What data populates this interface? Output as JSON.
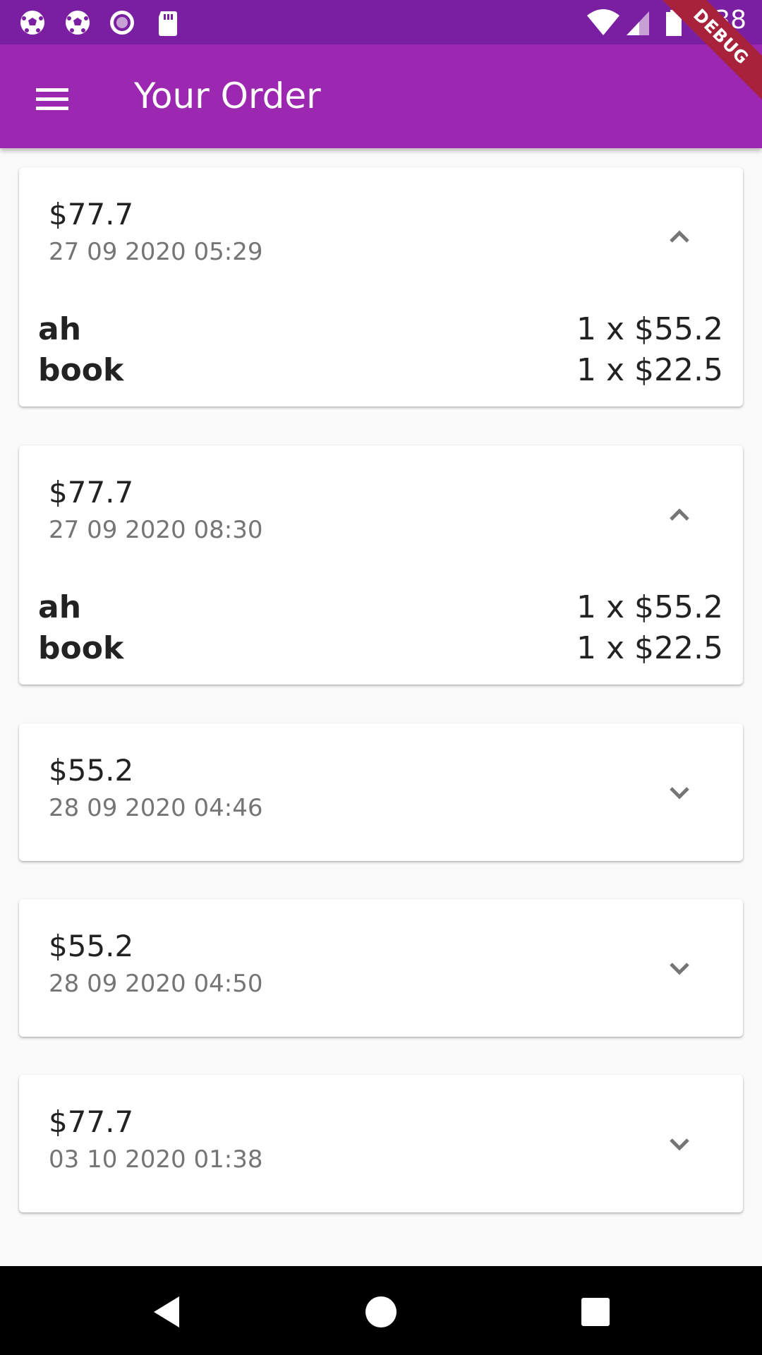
{
  "status_bar": {
    "time": "1:38",
    "icons": [
      "soccer-ball-icon",
      "soccer-ball-icon",
      "record-icon",
      "sd-card-icon",
      "wifi-icon",
      "signal-icon",
      "battery-icon"
    ]
  },
  "debug_banner": "DEBUG",
  "app_bar": {
    "menu_icon": "menu-icon",
    "title": "Your Order"
  },
  "orders": [
    {
      "amount": "$77.7",
      "date": "27 09 2020 05:29",
      "expanded": true,
      "items": [
        {
          "name": "ah",
          "qty": "1 x $55.2"
        },
        {
          "name": "book",
          "qty": "1 x $22.5"
        }
      ]
    },
    {
      "amount": "$77.7",
      "date": "27 09 2020 08:30",
      "expanded": true,
      "items": [
        {
          "name": "ah",
          "qty": "1 x $55.2"
        },
        {
          "name": "book",
          "qty": "1 x $22.5"
        }
      ]
    },
    {
      "amount": "$55.2",
      "date": "28 09 2020 04:46",
      "expanded": false,
      "items": []
    },
    {
      "amount": "$55.2",
      "date": "28 09 2020 04:50",
      "expanded": false,
      "items": []
    },
    {
      "amount": "$77.7",
      "date": "03 10 2020 01:38",
      "expanded": false,
      "items": []
    }
  ],
  "colors": {
    "status_bar": "#7b1fa2",
    "app_bar": "#9c27b0",
    "debug": "#a7223a"
  }
}
